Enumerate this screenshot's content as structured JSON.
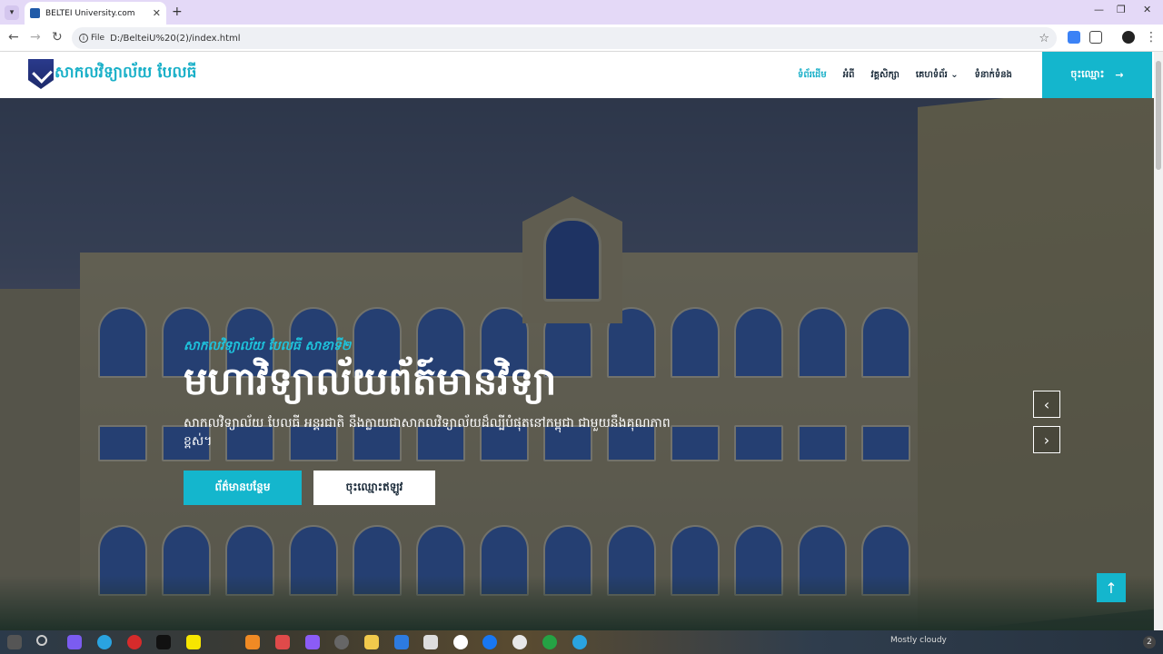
{
  "browser": {
    "tab_title": "BELTEI University.com",
    "tab_close": "✕",
    "new_tab": "+",
    "address_chip": "File",
    "url": "D:/BelteiU%20(2)/index.html",
    "min": "—",
    "restore": "❐",
    "close": "✕"
  },
  "site": {
    "brand": "សាកលវិទ្យាល័យ បែលធី",
    "menu": [
      {
        "label": "ទំព័រដើម"
      },
      {
        "label": "អំពី"
      },
      {
        "label": "វគ្គសិក្សា"
      },
      {
        "label": "គេហទំព័រ ⌄"
      },
      {
        "label": "ទំនាក់ទំនង"
      }
    ],
    "register": "ចុះឈ្មោះ",
    "register_arrow": "→"
  },
  "hero": {
    "subtitle": "សាកលវិទ្យាល័យ បែលធី សាខាទី២",
    "title": "មហាវិទ្យាល័យព័ត៍មានវិទ្យា",
    "description": "សាកលវិទ្យាល័យ បែលធី អន្តរជាតិ នឹងក្លាយជាសាកលវិទ្យាល័យដ៏ល្បីបំផុតនៅកម្ពុជា ជាមួយនឹងគុណភាពខ្ពស់។",
    "btn_more": "ព័ត៌មានបន្ថែម",
    "btn_register": "ចុះឈ្មោះឥឡូវ",
    "prev": "‹",
    "next": "›",
    "back_to_top": "↑"
  },
  "taskbar": {
    "weather": "Mostly cloudy",
    "notifications": "2"
  }
}
